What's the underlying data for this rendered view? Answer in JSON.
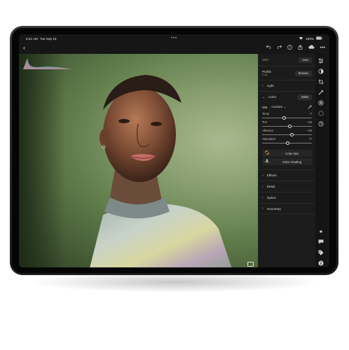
{
  "status": {
    "time": "9:41 AM",
    "date": "Tue Sep 15",
    "battery": "100%"
  },
  "toolbar": {
    "back_glyph": "‹"
  },
  "panel": {
    "auto_row": {
      "label": "WB?",
      "button": "Auto"
    },
    "profile": {
      "label": "Profile",
      "sub": "Color",
      "value": "Browse"
    },
    "sections": {
      "light": "Light",
      "color": "Color",
      "effects": "Effects",
      "detail": "Detail",
      "optics": "Optics",
      "geometry": "Geometry"
    },
    "color_mode": "B&W",
    "wb": {
      "label": "WB",
      "value": "Custom"
    },
    "sliders": [
      {
        "name": "Temp",
        "value": "-7",
        "pos": 0.45
      },
      {
        "name": "Tint",
        "value": "+16",
        "pos": 0.55
      },
      {
        "name": "Vibrance",
        "value": "+45",
        "pos": 0.6
      },
      {
        "name": "Saturation",
        "value": "+7",
        "pos": 0.52
      }
    ],
    "color_mix": "Color Mix",
    "color_grading": "Color Grading"
  }
}
